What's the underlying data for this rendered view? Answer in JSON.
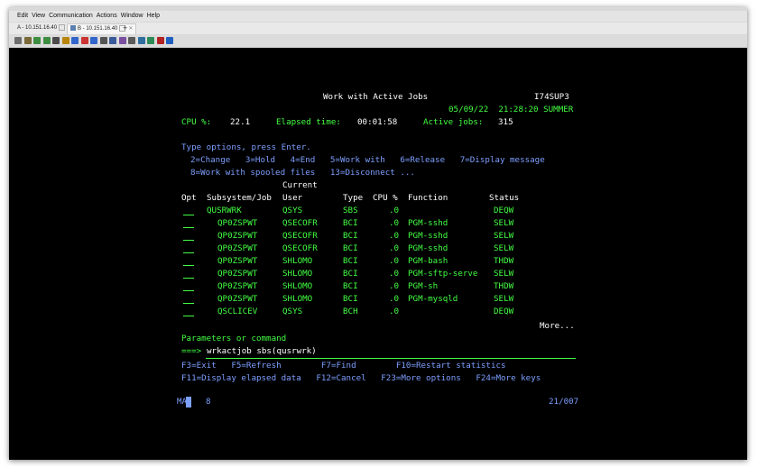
{
  "menubar": [
    "Edit",
    "View",
    "Communication",
    "Actions",
    "Window",
    "Help"
  ],
  "tabs": [
    {
      "label": "A - 10.151.16.40",
      "active": false
    },
    {
      "label": "B - 10.151.16.40",
      "active": true
    }
  ],
  "new_tab_symbol": "+",
  "toolbar_icons": [
    {
      "name": "copy-icon",
      "color": "#6d6d6d"
    },
    {
      "name": "paste-icon",
      "color": "#7a6a3a"
    },
    {
      "name": "send-file-icon",
      "color": "#3e8e41"
    },
    {
      "name": "receive-file-icon",
      "color": "#3e8e41"
    },
    {
      "name": "print-screen-icon",
      "color": "#4b4b4b"
    },
    {
      "name": "trim-icon",
      "color": "#b8860b"
    },
    {
      "name": "record-icon",
      "color": "#3366cc"
    },
    {
      "name": "stop-icon",
      "color": "#cc3333"
    },
    {
      "name": "play-icon",
      "color": "#3366cc"
    },
    {
      "name": "keypad-icon",
      "color": "#555555"
    },
    {
      "name": "display-icon",
      "color": "#3a5a9a"
    },
    {
      "name": "color-icon",
      "color": "#7a4fa0"
    },
    {
      "name": "settings-icon",
      "color": "#5a5a5a"
    },
    {
      "name": "macro-icon",
      "color": "#2f6f9f"
    },
    {
      "name": "connect-icon",
      "color": "#2e8b57"
    },
    {
      "name": "disconnect-icon",
      "color": "#b22222"
    },
    {
      "name": "help-icon",
      "color": "#1f5fbf"
    }
  ],
  "screen": {
    "title": "Work with Active Jobs",
    "system": "I74SUP3",
    "date_time": "05/09/22  21:28:20 SUMMER",
    "stats": {
      "cpu_label": "CPU %:",
      "cpu_value": "22.1",
      "elapsed_label": "Elapsed time:",
      "elapsed_value": "00:01:58",
      "active_label": "Active jobs:",
      "active_value": "315"
    },
    "instructions": "Type options, press Enter.",
    "options_line1": "2=Change   3=Hold   4=End   5=Work with   6=Release   7=Display message",
    "options_line2": "8=Work with spooled files   13=Disconnect ...",
    "columns": {
      "current": "Current",
      "opt": "Opt",
      "subsystem_job": "Subsystem/Job",
      "user": "User",
      "type": "Type",
      "cpu": "CPU %",
      "function": "Function",
      "status": "Status"
    },
    "jobs": [
      {
        "job": "QUSRWRK",
        "user": "QSYS",
        "type": "SBS",
        "cpu": ".0",
        "function": "",
        "status": "DEQW"
      },
      {
        "job": "QP0ZSPWT",
        "user": "QSECOFR",
        "type": "BCI",
        "cpu": ".0",
        "function": "PGM-sshd",
        "status": "SELW"
      },
      {
        "job": "QP0ZSPWT",
        "user": "QSECOFR",
        "type": "BCI",
        "cpu": ".0",
        "function": "PGM-sshd",
        "status": "SELW"
      },
      {
        "job": "QP0ZSPWT",
        "user": "QSECOFR",
        "type": "BCI",
        "cpu": ".0",
        "function": "PGM-sshd",
        "status": "SELW"
      },
      {
        "job": "QP0ZSPWT",
        "user": "SHLOMO",
        "type": "BCI",
        "cpu": ".0",
        "function": "PGM-bash",
        "status": "THDW"
      },
      {
        "job": "QP0ZSPWT",
        "user": "SHLOMO",
        "type": "BCI",
        "cpu": ".0",
        "function": "PGM-sftp-serve",
        "status": "SELW"
      },
      {
        "job": "QP0ZSPWT",
        "user": "SHLOMO",
        "type": "BCI",
        "cpu": ".0",
        "function": "PGM-sh",
        "status": "THDW"
      },
      {
        "job": "QP0ZSPWT",
        "user": "SHLOMO",
        "type": "BCI",
        "cpu": ".0",
        "function": "PGM-mysqld",
        "status": "SELW"
      },
      {
        "job": "QSCLICEV",
        "user": "QSYS",
        "type": "BCH",
        "cpu": ".0",
        "function": "",
        "status": "DEQW"
      }
    ],
    "more": "More...",
    "params_label": "Parameters or command",
    "prompt": "===>",
    "command": "wrkactjob sbs(qusrwrk)",
    "fkeys_line1": "F3=Exit   F5=Refresh        F7=Find        F10=Restart statistics",
    "fkeys_line2": "F11=Display elapsed data   F12=Cancel   F23=More options   F24=More keys",
    "status_left": "MA",
    "status_session": "8",
    "cursor_pos": "21/007"
  }
}
